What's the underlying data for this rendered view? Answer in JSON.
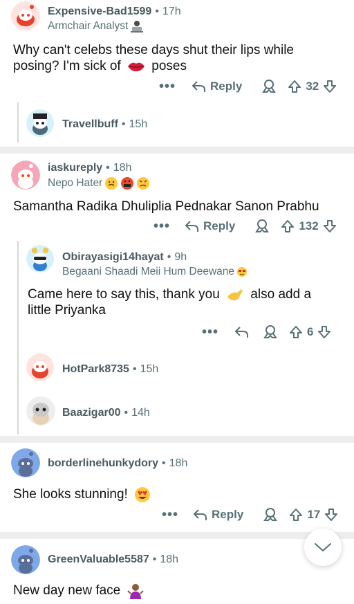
{
  "comments": [
    {
      "username": "Expensive-Bad1599",
      "time": "17h",
      "flair": "Armchair Analyst",
      "body_line1": "Why can't  celebs these days shut their lips while",
      "body_line2_a": "posing? I'm sick of",
      "body_line2_b": "poses",
      "reply_label": "Reply",
      "score": "32"
    },
    {
      "username": "Travellbuff",
      "time": "15h"
    },
    {
      "username": "iaskureply",
      "time": "18h",
      "flair": "Nepo Hater",
      "body": "Samantha Radika Dhuliplia Pednakar Sanon Prabhu",
      "reply_label": "Reply",
      "score": "132"
    },
    {
      "username": "Obirayasigi14hayat",
      "time": "9h",
      "flair": "Begaani Shaadi Meii Hum Deewane",
      "body_line1_a": "Came here to say this, thank you",
      "body_line1_b": "also add a",
      "body_line2": "little Priyanka",
      "score": "6"
    },
    {
      "username": "HotPark8735",
      "time": "15h"
    },
    {
      "username": "Baazigar00",
      "time": "14h"
    },
    {
      "username": "borderlinehunkydory",
      "time": "18h",
      "body": "She looks stunning!",
      "reply_label": "Reply",
      "score": "17"
    },
    {
      "username": "GreenValuable5587",
      "time": "18h",
      "body": "New day new face"
    }
  ],
  "icons": {
    "more": "ellipsis-icon",
    "reply": "reply-arrow-icon",
    "award": "award-icon",
    "upvote": "upvote-icon",
    "downvote": "downvote-icon",
    "scroll": "chevron-down-icon"
  },
  "colors": {
    "meta_text": "#576f76",
    "separator": "#eeeeee",
    "thread_line": "#d7d7d7"
  }
}
